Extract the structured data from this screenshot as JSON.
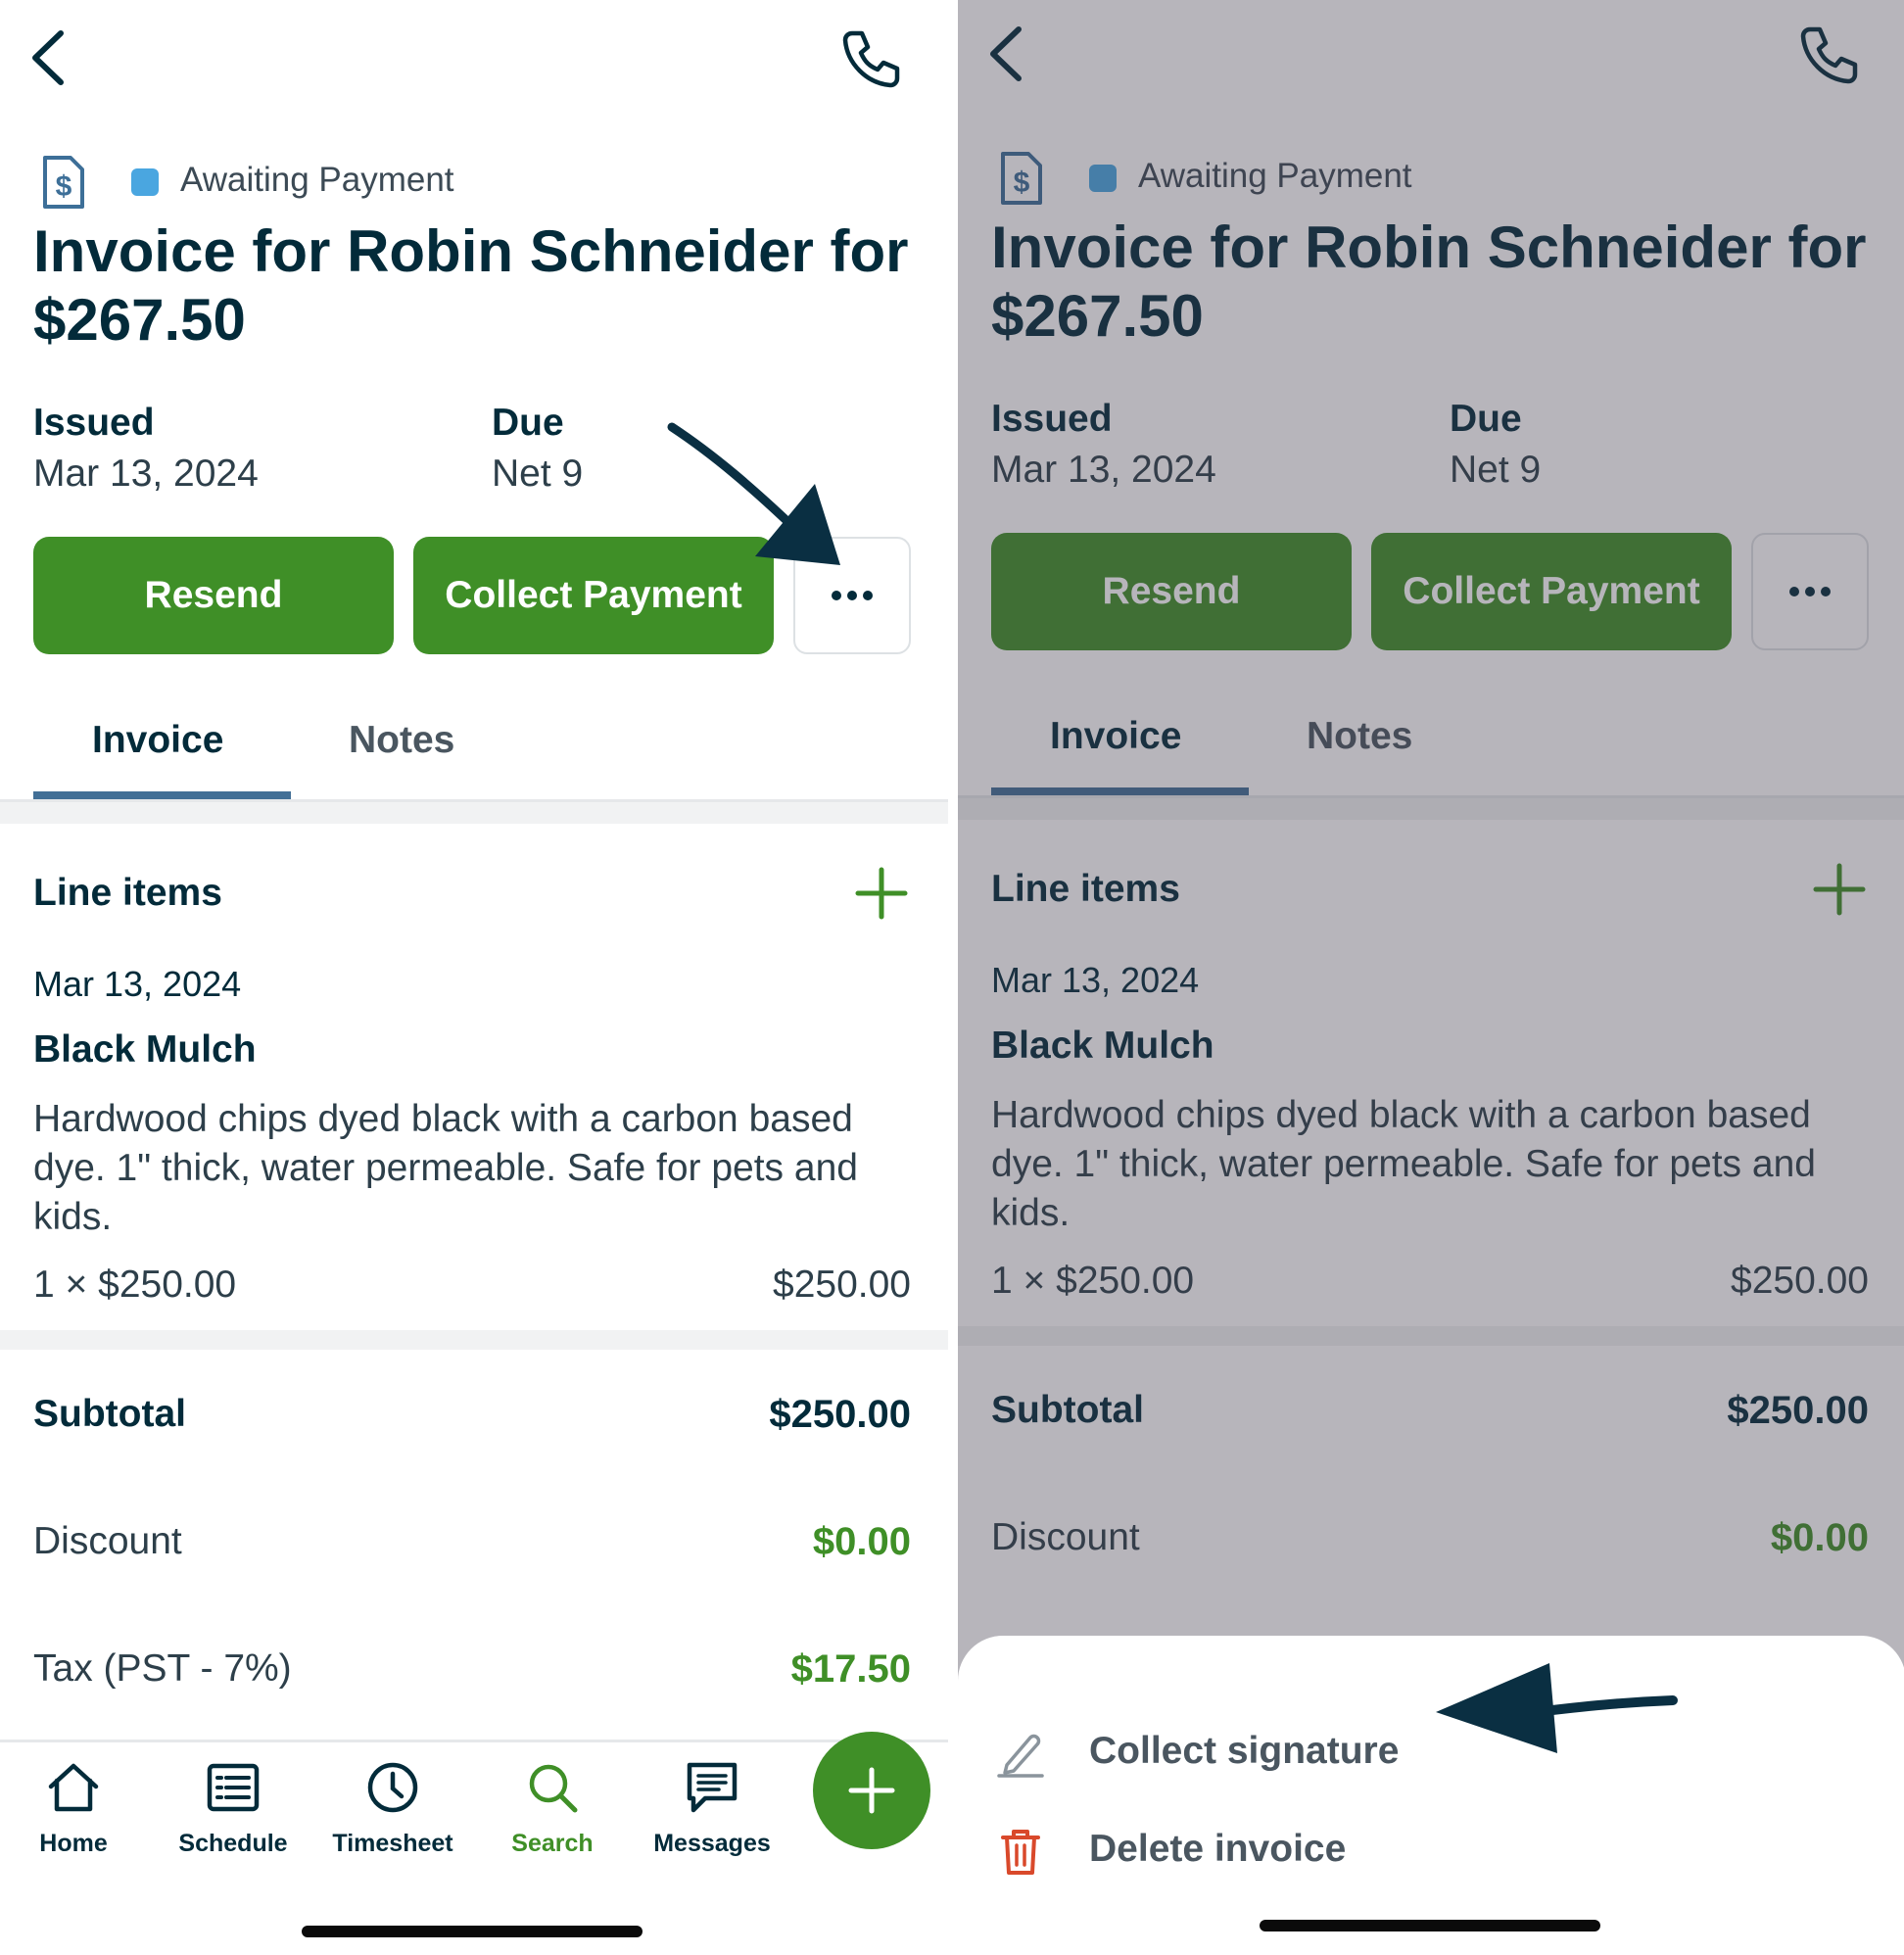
{
  "status": {
    "label": "Awaiting Payment",
    "color": "#4aa6e0"
  },
  "title": "Invoice for Robin Schneider for $267.50",
  "meta": {
    "issued_label": "Issued",
    "issued_value": "Mar 13, 2024",
    "due_label": "Due",
    "due_value": "Net 9"
  },
  "actions": {
    "resend": "Resend",
    "collect_payment": "Collect Payment",
    "more_icon": "ellipsis-icon"
  },
  "tabs": [
    {
      "label": "Invoice",
      "active": true
    },
    {
      "label": "Notes",
      "active": false
    }
  ],
  "line_items": {
    "title": "Line items",
    "add_icon": "plus-icon",
    "items": [
      {
        "date": "Mar 13, 2024",
        "name": "Black Mulch",
        "description": "Hardwood chips dyed black with a carbon based dye. 1\" thick, water permeable. Safe for pets and kids.",
        "quantity_price": "1 × $250.00",
        "total": "$250.00"
      }
    ]
  },
  "summary": {
    "subtotal_label": "Subtotal",
    "subtotal_value": "$250.00",
    "discount_label": "Discount",
    "discount_value": "$0.00",
    "tax_label": "Tax (PST - 7%)",
    "tax_value": "$17.50"
  },
  "bottom_nav": [
    {
      "label": "Home",
      "icon": "home-icon",
      "active": false
    },
    {
      "label": "Schedule",
      "icon": "schedule-list-icon",
      "active": false
    },
    {
      "label": "Timesheet",
      "icon": "clock-icon",
      "active": false
    },
    {
      "label": "Search",
      "icon": "search-icon",
      "active": true
    },
    {
      "label": "Messages",
      "icon": "message-icon",
      "active": false
    }
  ],
  "action_sheet": {
    "items": [
      {
        "label": "Collect signature",
        "icon": "pen-icon"
      },
      {
        "label": "Delete invoice",
        "icon": "trash-icon"
      }
    ]
  },
  "colors": {
    "primary_green": "#3f8f27",
    "navy_text": "#032b3a",
    "accent_blue": "#426f96",
    "danger_red": "#d9492b",
    "arrow": "#0a2f42"
  }
}
